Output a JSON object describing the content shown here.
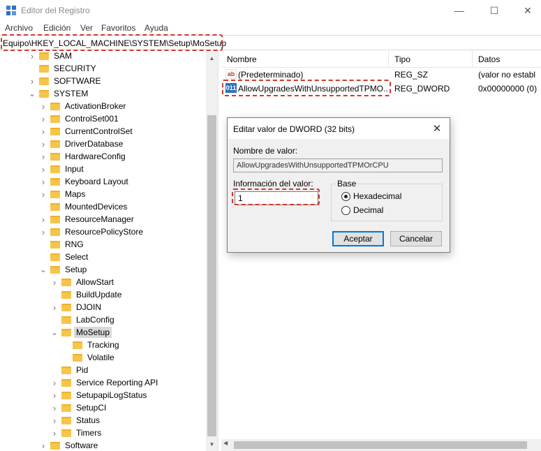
{
  "window": {
    "title": "Editor del Registro",
    "minimize_glyph": "—",
    "maximize_glyph": "☐",
    "close_glyph": "✕"
  },
  "menu": [
    "Archivo",
    "Edición",
    "Ver",
    "Favoritos",
    "Ayuda"
  ],
  "address": {
    "path": "Equipo\\HKEY_LOCAL_MACHINE\\SYSTEM\\Setup\\MoSetup"
  },
  "tree": {
    "items": [
      {
        "label": "SAM",
        "level": 1,
        "expander": "collapsed"
      },
      {
        "label": "SECURITY",
        "level": 1,
        "expander": "none"
      },
      {
        "label": "SOFTWARE",
        "level": 1,
        "expander": "collapsed"
      },
      {
        "label": "SYSTEM",
        "level": 1,
        "expander": "expanded"
      },
      {
        "label": "ActivationBroker",
        "level": 2,
        "expander": "collapsed"
      },
      {
        "label": "ControlSet001",
        "level": 2,
        "expander": "collapsed"
      },
      {
        "label": "CurrentControlSet",
        "level": 2,
        "expander": "collapsed"
      },
      {
        "label": "DriverDatabase",
        "level": 2,
        "expander": "collapsed"
      },
      {
        "label": "HardwareConfig",
        "level": 2,
        "expander": "collapsed"
      },
      {
        "label": "Input",
        "level": 2,
        "expander": "collapsed"
      },
      {
        "label": "Keyboard Layout",
        "level": 2,
        "expander": "collapsed"
      },
      {
        "label": "Maps",
        "level": 2,
        "expander": "collapsed"
      },
      {
        "label": "MountedDevices",
        "level": 2,
        "expander": "none"
      },
      {
        "label": "ResourceManager",
        "level": 2,
        "expander": "collapsed"
      },
      {
        "label": "ResourcePolicyStore",
        "level": 2,
        "expander": "collapsed"
      },
      {
        "label": "RNG",
        "level": 2,
        "expander": "none"
      },
      {
        "label": "Select",
        "level": 2,
        "expander": "none"
      },
      {
        "label": "Setup",
        "level": 2,
        "expander": "expanded"
      },
      {
        "label": "AllowStart",
        "level": 3,
        "expander": "collapsed"
      },
      {
        "label": "BuildUpdate",
        "level": 3,
        "expander": "none"
      },
      {
        "label": "DJOIN",
        "level": 3,
        "expander": "collapsed"
      },
      {
        "label": "LabConfig",
        "level": 3,
        "expander": "none"
      },
      {
        "label": "MoSetup",
        "level": 3,
        "expander": "expanded",
        "selected": true
      },
      {
        "label": "Tracking",
        "level": 4,
        "expander": "none"
      },
      {
        "label": "Volatile",
        "level": 4,
        "expander": "none"
      },
      {
        "label": "Pid",
        "level": 3,
        "expander": "none"
      },
      {
        "label": "Service Reporting API",
        "level": 3,
        "expander": "collapsed"
      },
      {
        "label": "SetupapiLogStatus",
        "level": 3,
        "expander": "collapsed"
      },
      {
        "label": "SetupCI",
        "level": 3,
        "expander": "collapsed"
      },
      {
        "label": "Status",
        "level": 3,
        "expander": "collapsed"
      },
      {
        "label": "Timers",
        "level": 3,
        "expander": "collapsed"
      },
      {
        "label": "Software",
        "level": 2,
        "expander": "collapsed"
      }
    ]
  },
  "list": {
    "columns": [
      "Nombre",
      "Tipo",
      "Datos"
    ],
    "rows": [
      {
        "icon": "string-value-icon",
        "icon_text": "ab",
        "name": "(Predeterminado)",
        "type": "REG_SZ",
        "data": "(valor no establ"
      },
      {
        "icon": "dword-value-icon",
        "icon_text": "011",
        "name": "AllowUpgradesWithUnsupportedTPMO...",
        "type": "REG_DWORD",
        "data": "0x00000000 (0)"
      }
    ]
  },
  "dialog": {
    "title": "Editar valor de DWORD (32 bits)",
    "close_glyph": "✕",
    "value_name_label": "Nombre de valor:",
    "value_name": "AllowUpgradesWithUnsupportedTPMOrCPU",
    "value_data_label": "Información del valor:",
    "value_data": "1",
    "base_label": "Base",
    "base_options": [
      {
        "label": "Hexadecimal",
        "checked": true
      },
      {
        "label": "Decimal",
        "checked": false
      }
    ],
    "ok_label": "Aceptar",
    "cancel_label": "Cancelar"
  },
  "colors": {
    "highlight_dash": "#d0382a",
    "folder": "#f6c54a",
    "default_button_border": "#0078d7"
  }
}
